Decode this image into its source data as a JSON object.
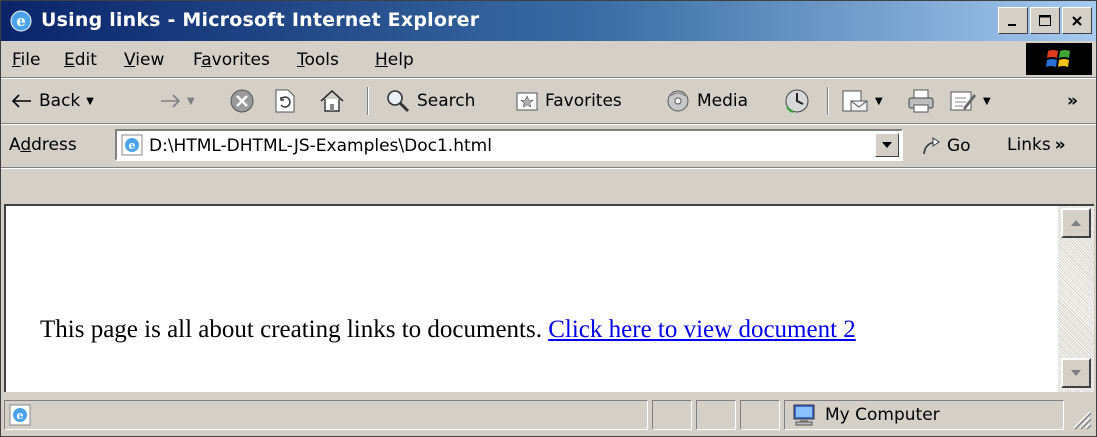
{
  "window": {
    "title": "Using links - Microsoft Internet Explorer"
  },
  "menu": {
    "items": [
      {
        "prefix": "",
        "key": "F",
        "rest": "ile"
      },
      {
        "prefix": "",
        "key": "E",
        "rest": "dit"
      },
      {
        "prefix": "",
        "key": "V",
        "rest": "iew"
      },
      {
        "prefix": "F",
        "key": "a",
        "rest": "vorites"
      },
      {
        "prefix": "",
        "key": "T",
        "rest": "ools"
      },
      {
        "prefix": "",
        "key": "H",
        "rest": "elp"
      }
    ]
  },
  "toolbar": {
    "back_label": "Back",
    "search_label": "Search",
    "favorites_label": "Favorites",
    "media_label": "Media",
    "overflow": "»"
  },
  "address": {
    "label_prefix": "A",
    "label_key": "d",
    "label_rest": "dress",
    "value": "D:\\HTML-DHTML-JS-Examples\\Doc1.html",
    "go_label": "Go",
    "links_label": "Links",
    "links_overflow": "»"
  },
  "page": {
    "text": "This page is all about creating links to documents. ",
    "link_text": "Click here to view document 2"
  },
  "status": {
    "zone_label": "My Computer"
  }
}
